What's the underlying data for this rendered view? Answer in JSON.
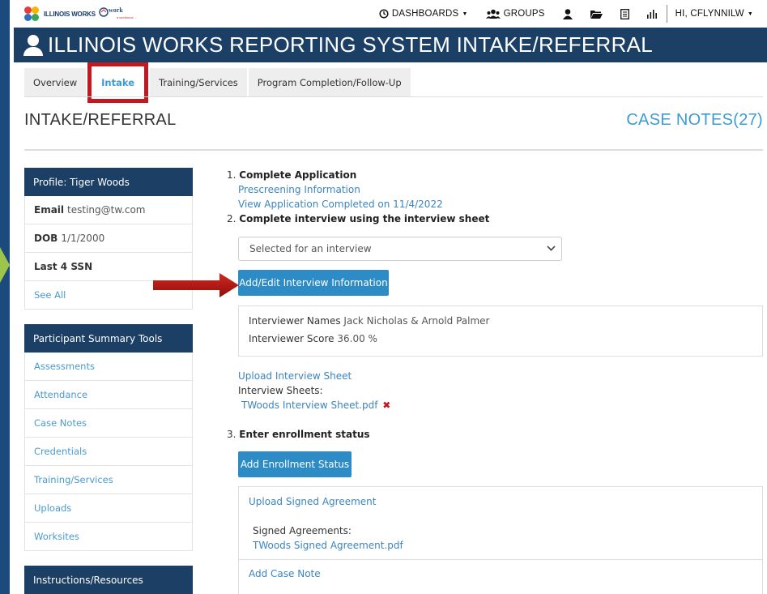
{
  "topbar": {
    "logo_text": "ILLINOIS WORKS",
    "logo2_text": "work",
    "logo2_tagline": "a workforce ...",
    "nav": {
      "dashboards": "DASHBOARDS",
      "groups": "GROUPS",
      "user": "HI, CFLYNNILW"
    }
  },
  "header": {
    "title": "ILLINOIS WORKS REPORTING SYSTEM INTAKE/REFERRAL"
  },
  "tabs": [
    {
      "label": "Overview"
    },
    {
      "label": "Intake"
    },
    {
      "label": "Training/Services"
    },
    {
      "label": "Program Completion/Follow-Up"
    }
  ],
  "page": {
    "title": "INTAKE/REFERRAL",
    "case_notes": "CASE NOTES(27)"
  },
  "profile": {
    "header": "Profile: Tiger Woods",
    "email_label": "Email",
    "email_value": "testing@tw.com",
    "dob_label": "DOB",
    "dob_value": "1/1/2000",
    "ssn_label": "Last 4 SSN",
    "see_all": "See All"
  },
  "summary_tools": {
    "header": "Participant Summary Tools",
    "items": [
      "Assessments",
      "Attendance",
      "Case Notes",
      "Credentials",
      "Training/Services",
      "Uploads",
      "Worksites"
    ]
  },
  "instructions": {
    "header": "Instructions/Resources"
  },
  "steps": {
    "step1_num": "1.",
    "step1_title": "Complete Application",
    "prescreening_link": "Prescreening Information",
    "view_application_link": "View Application Completed on 11/4/2022",
    "step2_num": "2.",
    "step2_title": "Complete interview using the",
    "step2_link": "interview sheet",
    "interview_select_value": "Selected for an interview",
    "add_edit_interview_button": "Add/Edit Interview Information",
    "interviewer_names_label": "Interviewer Names",
    "interviewer_names_value": "Jack Nicholas & Arnold Palmer",
    "interviewer_score_label": "Interviewer Score",
    "interviewer_score_value": "36.00 %",
    "upload_interview_link": "Upload Interview Sheet",
    "interview_sheets_label": "Interview Sheets:",
    "interview_sheet_file": "TWoods Interview Sheet.pdf",
    "step3_num": "3.",
    "step3_title": "Enter enrollment status",
    "add_enrollment_button": "Add Enrollment Status",
    "upload_signed_link": "Upload Signed Agreement",
    "signed_agreements_label": "Signed Agreements:",
    "signed_agreement_file": "TWoods Signed Agreement.pdf",
    "add_case_note_link": "Add Case Note"
  },
  "colors": {
    "navy": "#1c3f66",
    "accent_blue": "#3c9bd3",
    "button_blue": "#2d8cc5",
    "highlight_red": "#c41820"
  }
}
